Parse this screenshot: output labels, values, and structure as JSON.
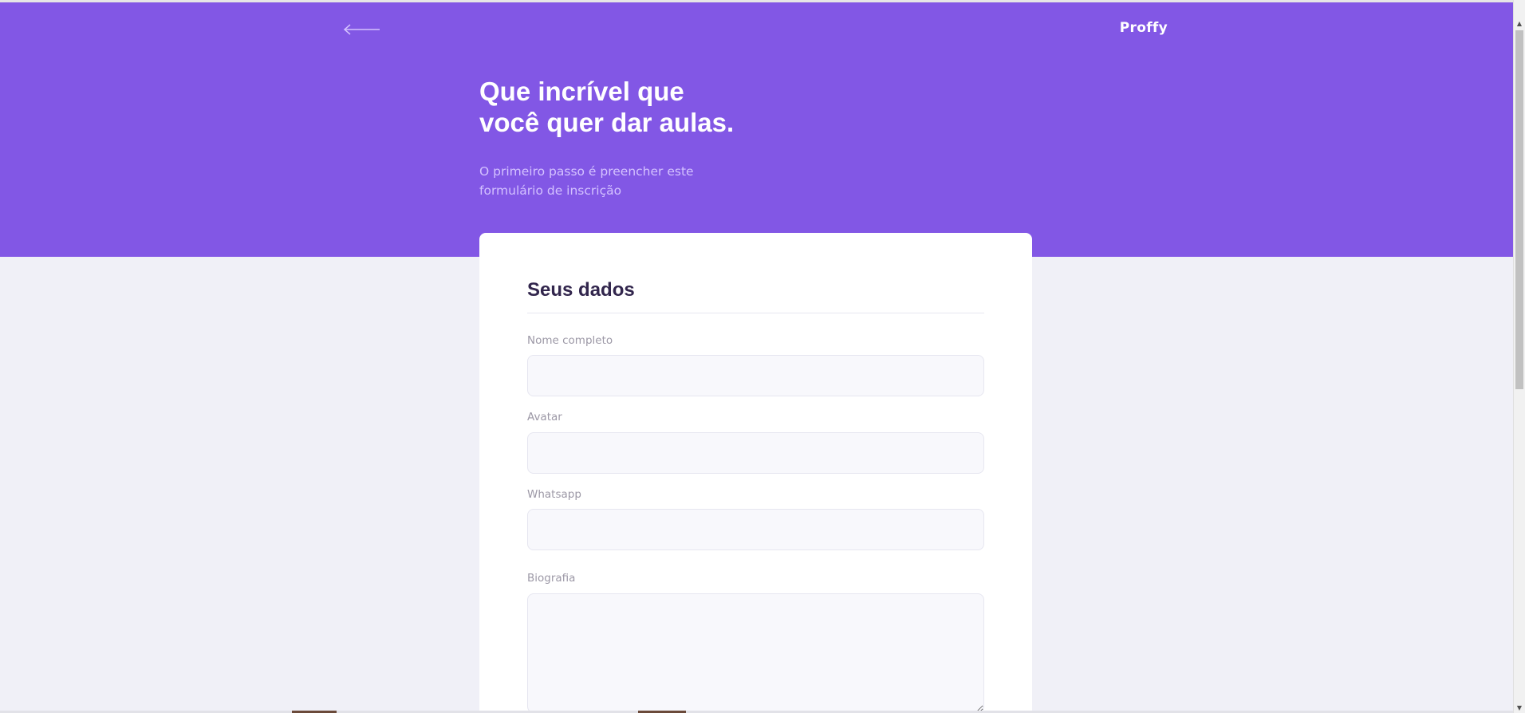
{
  "header": {
    "logo": "Proffy",
    "back_icon": "arrow-left-icon",
    "title_line1": "Que incrível que",
    "title_line2": "você quer dar aulas.",
    "subtitle_line1": "O primeiro passo é preencher este",
    "subtitle_line2": "formulário de inscrição"
  },
  "form": {
    "section_title": "Seus dados",
    "fields": [
      {
        "label": "Nome completo",
        "value": ""
      },
      {
        "label": "Avatar",
        "value": ""
      },
      {
        "label": "Whatsapp",
        "value": ""
      },
      {
        "label": "Biografia",
        "value": ""
      }
    ]
  },
  "colors": {
    "primary": "#8257e5",
    "page_background": "#f0f0f7",
    "title_in_primary": "#ffffff",
    "text_in_primary": "#d4c2ff",
    "text_title": "#32264d",
    "text_complement": "#9c98a6",
    "input_background": "#f8f8fc",
    "line": "#e6e6f0"
  },
  "scrollbar": {
    "up_icon": "scroll-up-arrow-icon",
    "down_icon": "scroll-down-arrow-icon"
  }
}
